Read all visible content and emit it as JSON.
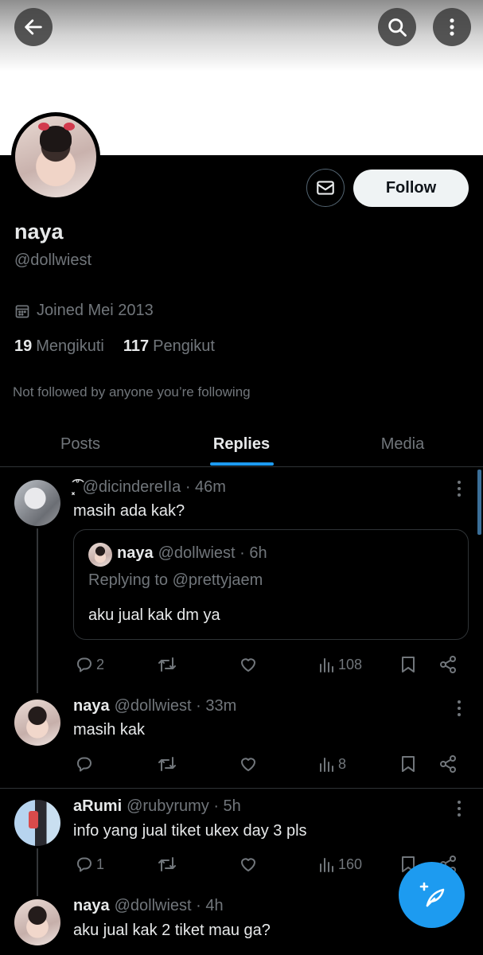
{
  "header": {
    "back_icon": "arrow-left-icon",
    "search_icon": "search-icon",
    "more_icon": "more-vertical-icon"
  },
  "profile": {
    "name": "naya",
    "handle": "@dollwiest",
    "follow_label": "Follow",
    "message_icon": "mail-icon",
    "joined": "Joined Mei 2013",
    "following_count": "19",
    "following_label": "Mengikuti",
    "followers_count": "117",
    "followers_label": "Pengikut",
    "not_followed": "Not followed by anyone you’re following"
  },
  "tabs": [
    {
      "label": "Posts",
      "active": false
    },
    {
      "label": "Replies",
      "active": true
    },
    {
      "label": "Media",
      "active": false
    }
  ],
  "posts": [
    {
      "name": "͓͡ ̊",
      "handle": "@dicindereIIa",
      "time": "· 46m",
      "text": "masih ada kak?",
      "quote": {
        "name": "naya",
        "handle": "@dollwiest",
        "time": "· 6h",
        "replying": "Replying to @prettyjaem",
        "text": "aku jual kak dm ya"
      },
      "replies": "2",
      "retweets": "",
      "likes": "",
      "views": "108"
    },
    {
      "name": "naya",
      "handle": "@dollwiest",
      "time": "· 33m",
      "text": "masih kak",
      "replies": "",
      "retweets": "",
      "likes": "",
      "views": "8"
    },
    {
      "name": "aRumi",
      "handle": "@rubyrumy",
      "time": "· 5h",
      "text": "info yang jual tiket ukex day 3 pls",
      "replies": "1",
      "retweets": "",
      "likes": "",
      "views": "160"
    },
    {
      "name": "naya",
      "handle": "@dollwiest",
      "time": "· 4h",
      "text": "aku jual kak 2 tiket mau ga?"
    }
  ],
  "colors": {
    "accent": "#1d9bf0",
    "background": "#000000",
    "text_primary": "#e7e9ea",
    "text_secondary": "#71767b"
  },
  "fab": {
    "icon": "compose-feather-icon"
  }
}
